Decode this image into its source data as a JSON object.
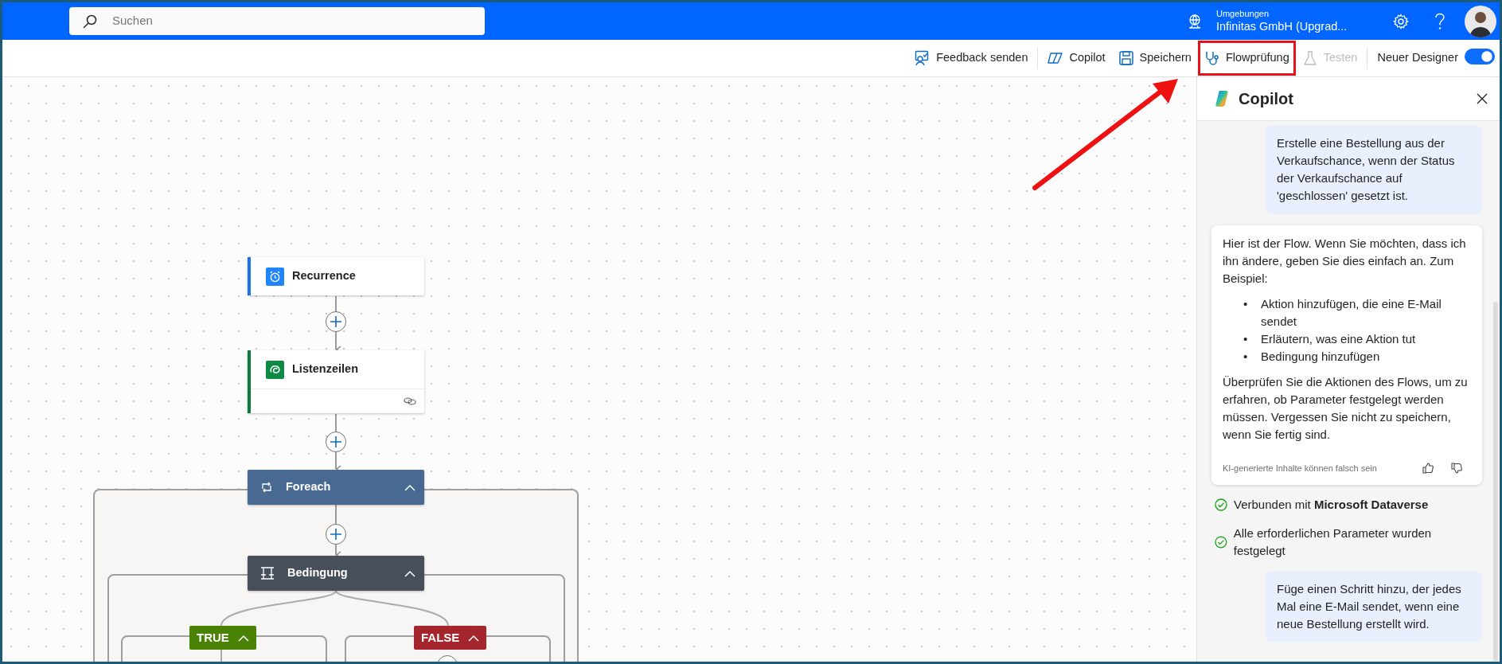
{
  "search": {
    "placeholder": "Suchen"
  },
  "environment": {
    "label": "Umgebungen",
    "name": "Infinitas GmbH (Upgrad..."
  },
  "toolbar": [
    {
      "label": "Feedback senden",
      "disabled": false,
      "highlighted": false
    },
    {
      "label": "Copilot",
      "disabled": false,
      "highlighted": false
    },
    {
      "label": "Speichern",
      "disabled": false,
      "highlighted": false
    },
    {
      "label": "Flowprüfung",
      "disabled": false,
      "highlighted": true
    },
    {
      "label": "Testen",
      "disabled": true,
      "highlighted": false
    }
  ],
  "designer_toggle": {
    "label": "Neuer Designer",
    "on": true
  },
  "flow": {
    "nodes": [
      {
        "kind": "trigger",
        "title": "Recurrence"
      },
      {
        "kind": "action",
        "title": "Listenzeilen"
      },
      {
        "kind": "loop",
        "title": "Foreach",
        "expanded": true
      },
      {
        "kind": "condition",
        "title": "Bedingung",
        "expanded": true
      }
    ],
    "branches": [
      {
        "kind": "true",
        "label": "TRUE",
        "expanded": true
      },
      {
        "kind": "false",
        "label": "FALSE",
        "expanded": true
      }
    ]
  },
  "copilot": {
    "title": "Copilot",
    "messages": [
      {
        "kind": "user",
        "text": "Erstelle eine Bestellung aus der Verkaufschance, wenn der Status der Verkaufschance auf 'geschlossen' gesetzt ist."
      },
      {
        "kind": "assistant",
        "blocks": [
          {
            "kind": "text",
            "text": "Hier ist der Flow. Wenn Sie möchten, dass ich ihn ändere, geben Sie dies einfach an. Zum Beispiel:"
          },
          {
            "kind": "list",
            "marker": "•",
            "items": [
              "Aktion hinzufügen, die eine E-Mail sendet",
              "Erläutern, was eine Aktion tut",
              "Bedingung hinzufügen"
            ]
          },
          {
            "kind": "text",
            "text": "Überprüfen Sie die Aktionen des Flows, um zu erfahren, ob Parameter festgelegt werden müssen. Vergessen Sie nicht zu speichern, wenn Sie fertig sind."
          }
        ],
        "disclaimer": "KI-generierte Inhalte können falsch sein"
      },
      {
        "kind": "status",
        "text": "Verbunden mit **Microsoft Dataverse**"
      },
      {
        "kind": "status",
        "text": "Alle erforderlichen Parameter wurden festgelegt"
      },
      {
        "kind": "user",
        "text": "Füge einen Schritt hinzu, der jedes Mal eine E-Mail sendet, wenn eine neue Bestellung erstellt wird."
      }
    ]
  }
}
